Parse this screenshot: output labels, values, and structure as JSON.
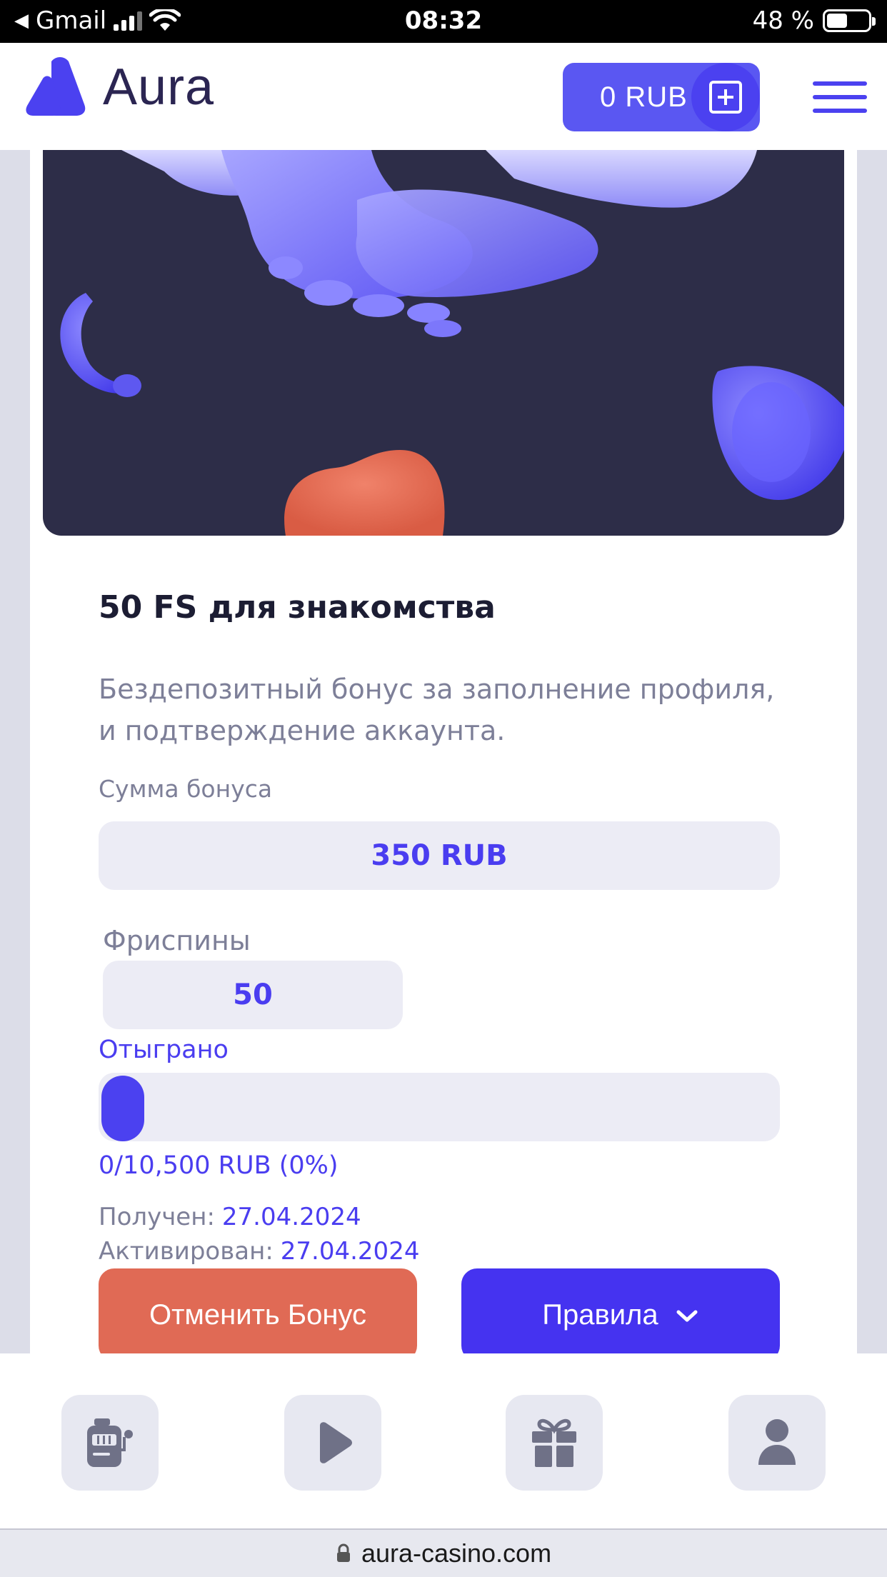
{
  "status_bar": {
    "back_app": "Gmail",
    "time": "08:32",
    "battery": "48 %"
  },
  "header": {
    "logo_text": "Aura",
    "balance": "0 RUB",
    "brand_color": "#4b41f0"
  },
  "bonus": {
    "title": "50 FS для знакомства",
    "description": "Бездепозитный бонус за заполнение профиля, и подтверждение аккаунта.",
    "amount_label": "Сумма бонуса",
    "amount_value": "350 RUB",
    "freespins_label": "Фриспины",
    "freespins_value": "50",
    "wager_label": "Отыграно",
    "wager_progress_percent": 0,
    "wager_text": "0/10,500 RUB (0%)",
    "received_label": "Получен:",
    "received_date": "27.04.2024",
    "activated_label": "Активирован:",
    "activated_date": "27.04.2024",
    "cancel_button": "Отменить Бонус",
    "rules_button": "Правила"
  },
  "bottom_nav": {
    "items": [
      {
        "icon": "slot-machine-icon"
      },
      {
        "icon": "play-icon"
      },
      {
        "icon": "gift-icon"
      },
      {
        "icon": "user-icon"
      }
    ]
  },
  "browser": {
    "url": "aura-casino.com"
  }
}
